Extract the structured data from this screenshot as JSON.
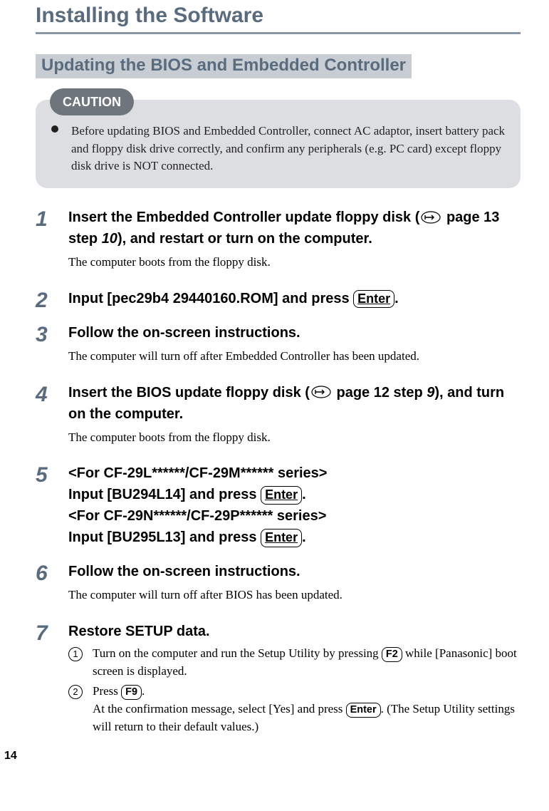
{
  "page_number": "14",
  "chapter_title": "Installing the Software",
  "section_title": "Updating the BIOS and Embedded Controller",
  "caution": {
    "label": "CAUTION",
    "text": "Before updating BIOS and Embedded Controller, connect AC adaptor, insert battery pack and floppy disk drive correctly, and confirm any peripherals (e.g. PC card) except floppy disk drive is NOT connected."
  },
  "steps": {
    "s1": {
      "num": "1",
      "head_a": "Insert the Embedded Controller update floppy disk (",
      "head_b": " page 13 step ",
      "head_italic": "10",
      "head_c": "), and restart or turn on the computer.",
      "para": "The computer boots from the floppy disk."
    },
    "s2": {
      "num": "2",
      "head_a": "Input [pec29b4 29440160.ROM] and press ",
      "key": "Enter",
      "head_b": "."
    },
    "s3": {
      "num": "3",
      "head": "Follow the on-screen instructions.",
      "para": "The computer will turn off after Embedded Controller has been updated."
    },
    "s4": {
      "num": "4",
      "head_a": "Insert the BIOS update floppy disk (",
      "head_b": " page 12 step ",
      "head_italic": "9",
      "head_c": "), and turn on the computer.",
      "para": "The computer boots from the floppy disk."
    },
    "s5": {
      "num": "5",
      "line1_a": "<For CF-29L******/CF-29M****** series>",
      "line2_a": "Input [BU294L14] and press ",
      "line2_key": "Enter",
      "line2_b": ".",
      "line3_a": "<For CF-29N******/CF-29P****** series>",
      "line4_a": "Input [BU295L13] and press ",
      "line4_key": "Enter",
      "line4_b": "."
    },
    "s6": {
      "num": "6",
      "head": "Follow the on-screen instructions.",
      "para": "The computer will turn off after BIOS has been updated."
    },
    "s7": {
      "num": "7",
      "head": "Restore SETUP data.",
      "sub1": {
        "num": "1",
        "a": "Turn on the computer and run the Setup Utility by pressing ",
        "key": "F2",
        "b": " while [Panasonic] boot screen is displayed."
      },
      "sub2": {
        "num": "2",
        "a": "Press ",
        "key": "F9",
        "b": ".",
        "c": "At the confirmation message, select [Yes] and press ",
        "key2": "Enter",
        "d": ". (The Setup Utility settings will return to their default values.)"
      }
    }
  }
}
